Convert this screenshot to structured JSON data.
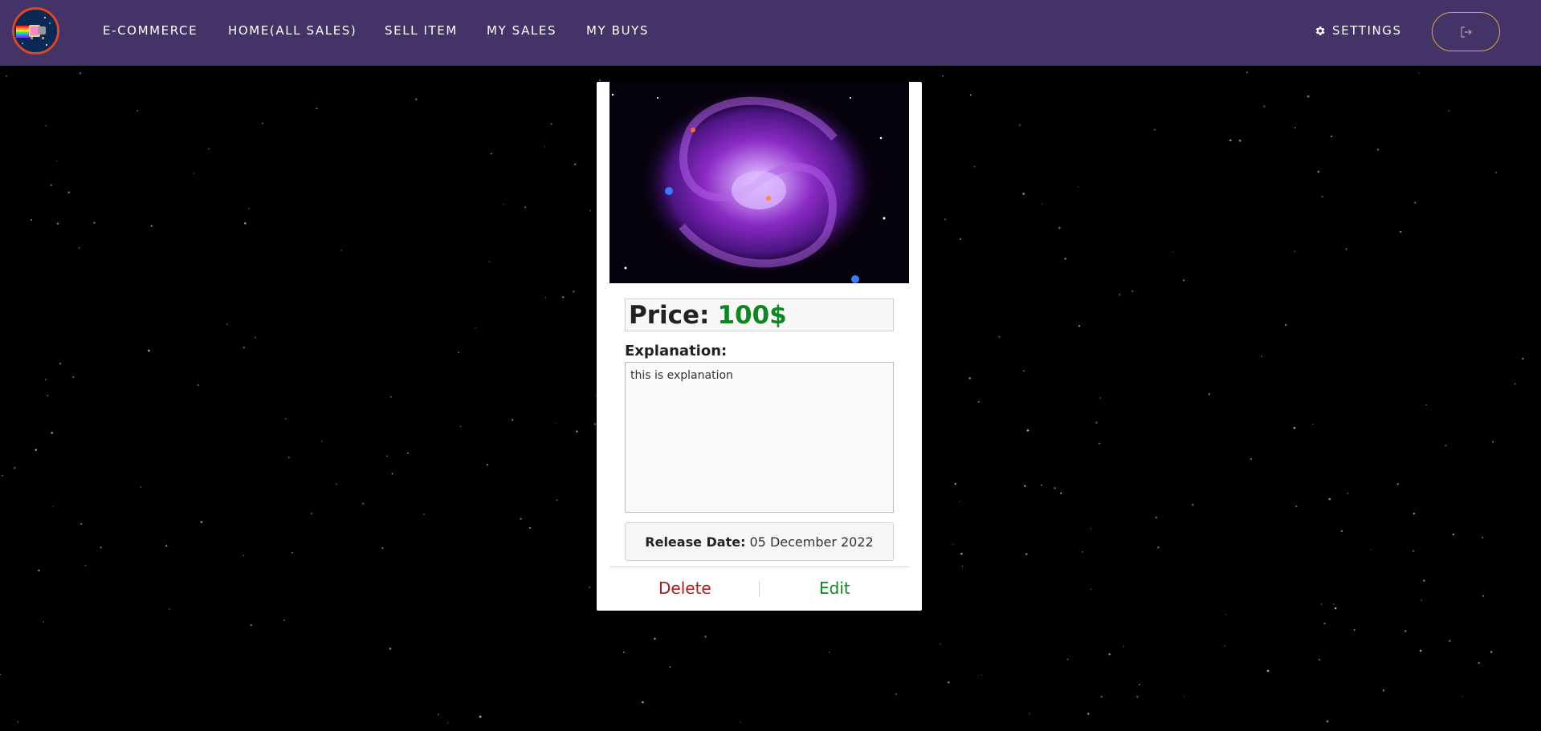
{
  "nav": {
    "links": [
      "E-COMMERCE",
      "HOME(ALL SALES)",
      "SELL ITEM",
      "MY SALES",
      "MY BUYS"
    ],
    "settings_label": "SETTINGS",
    "logout_icon": "logout-icon"
  },
  "product": {
    "price_label": "Price:",
    "price_value": "100$",
    "explanation_label": "Explanation:",
    "explanation_text": "this is explanation",
    "release_label": "Release Date:",
    "release_value": "05 December 2022",
    "delete_label": "Delete",
    "edit_label": "Edit"
  },
  "colors": {
    "navbar": "#443366",
    "price": "#0a8a1e",
    "delete": "#a51c1c",
    "edit": "#0a8a1e",
    "logo_border": "#e2461e",
    "logout_border": "#d8a44c"
  }
}
